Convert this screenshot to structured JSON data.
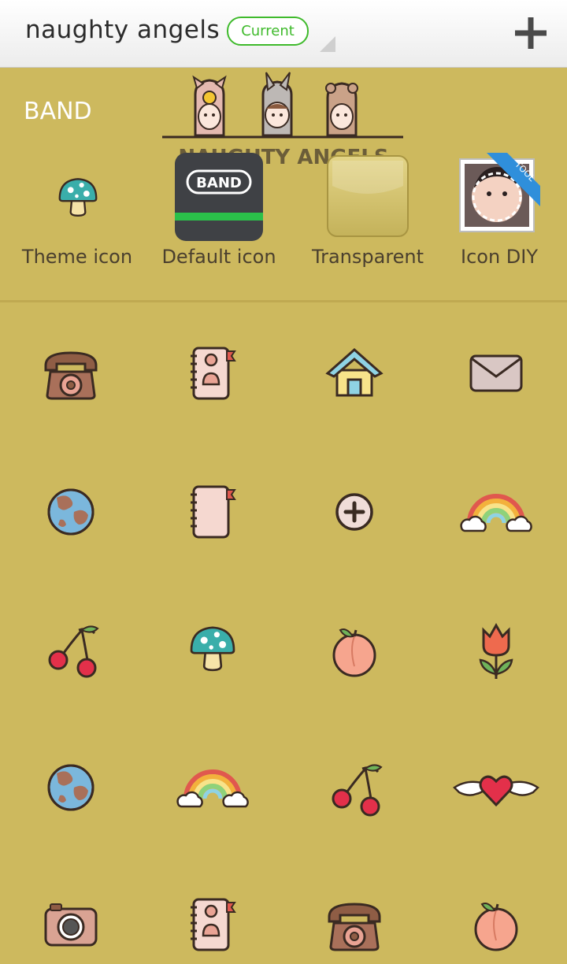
{
  "header": {
    "title": "naughty angels",
    "badge": "Current"
  },
  "app": {
    "name": "BAND",
    "banner_text": "NAUGHTY ANGELS"
  },
  "icon_options": [
    {
      "label": "Theme icon",
      "icon": "mushroom-icon"
    },
    {
      "label": "Default icon",
      "icon": "band-app-icon",
      "icon_text": "BAND"
    },
    {
      "label": "Transparent",
      "icon": "transparent-icon"
    },
    {
      "label": "Icon DIY",
      "icon": "photo-icon",
      "ribbon": "TOOL"
    }
  ],
  "icon_grid": [
    [
      "telephone-icon",
      "contacts-book-icon",
      "house-icon",
      "envelope-icon"
    ],
    [
      "globe-icon",
      "notebook-icon",
      "plus-circle-icon",
      "rainbow-icon"
    ],
    [
      "cherry-icon",
      "mushroom-icon",
      "peach-icon",
      "tulip-icon"
    ],
    [
      "globe-icon",
      "rainbow-icon",
      "cherry-icon",
      "winged-heart-icon"
    ],
    [
      "camera-icon",
      "contacts-book-icon",
      "telephone-icon",
      "peach-icon"
    ]
  ],
  "colors": {
    "background": "#cdb95e",
    "accent": "#3fba2c",
    "divider": "#bfa951"
  }
}
